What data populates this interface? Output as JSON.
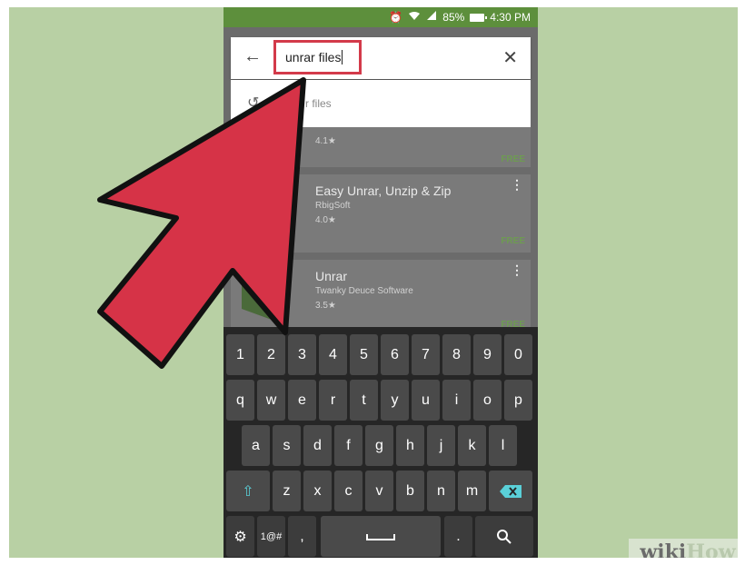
{
  "colors": {
    "background": "#b8d0a4",
    "status_bar": "#5d8f3c",
    "arrow": "#d63347",
    "search_highlight": "#d33a4a",
    "free_label": "#6e9b52"
  },
  "status_bar": {
    "icons": [
      "alarm-icon",
      "wifi-icon",
      "signal-icon",
      "battery-icon"
    ],
    "battery_percent": "85%",
    "time": "4:30 PM"
  },
  "search": {
    "query": "unrar files",
    "back_icon": "arrow-left-icon",
    "clear_icon": "close-icon"
  },
  "suggestion": {
    "icon": "history-icon",
    "text": "r files"
  },
  "results": [
    {
      "title": "",
      "developer": "",
      "rating": "4.1★",
      "price": "FREE"
    },
    {
      "title": "Easy Unrar, Unzip & Zip",
      "developer": "RbigSoft",
      "rating": "4.0★",
      "price": "FREE"
    },
    {
      "title": "Unrar",
      "developer": "Twanky Deuce Software",
      "rating": "3.5★",
      "price": "FREE"
    }
  ],
  "keyboard": {
    "row1": [
      "1",
      "2",
      "3",
      "4",
      "5",
      "6",
      "7",
      "8",
      "9",
      "0"
    ],
    "row2": [
      "q",
      "w",
      "e",
      "r",
      "t",
      "y",
      "u",
      "i",
      "o",
      "p"
    ],
    "row3": [
      "a",
      "s",
      "d",
      "f",
      "g",
      "h",
      "j",
      "k",
      "l"
    ],
    "row4": [
      "shift-icon",
      "z",
      "x",
      "c",
      "v",
      "b",
      "n",
      "m",
      "backspace-icon"
    ],
    "row5": {
      "settings": "⚙",
      "symbols": "1@#",
      "comma": ",",
      "space": "space-icon",
      "period": ".",
      "search": "search-icon"
    }
  },
  "watermark": {
    "wiki": "wiki",
    "how": "How"
  }
}
